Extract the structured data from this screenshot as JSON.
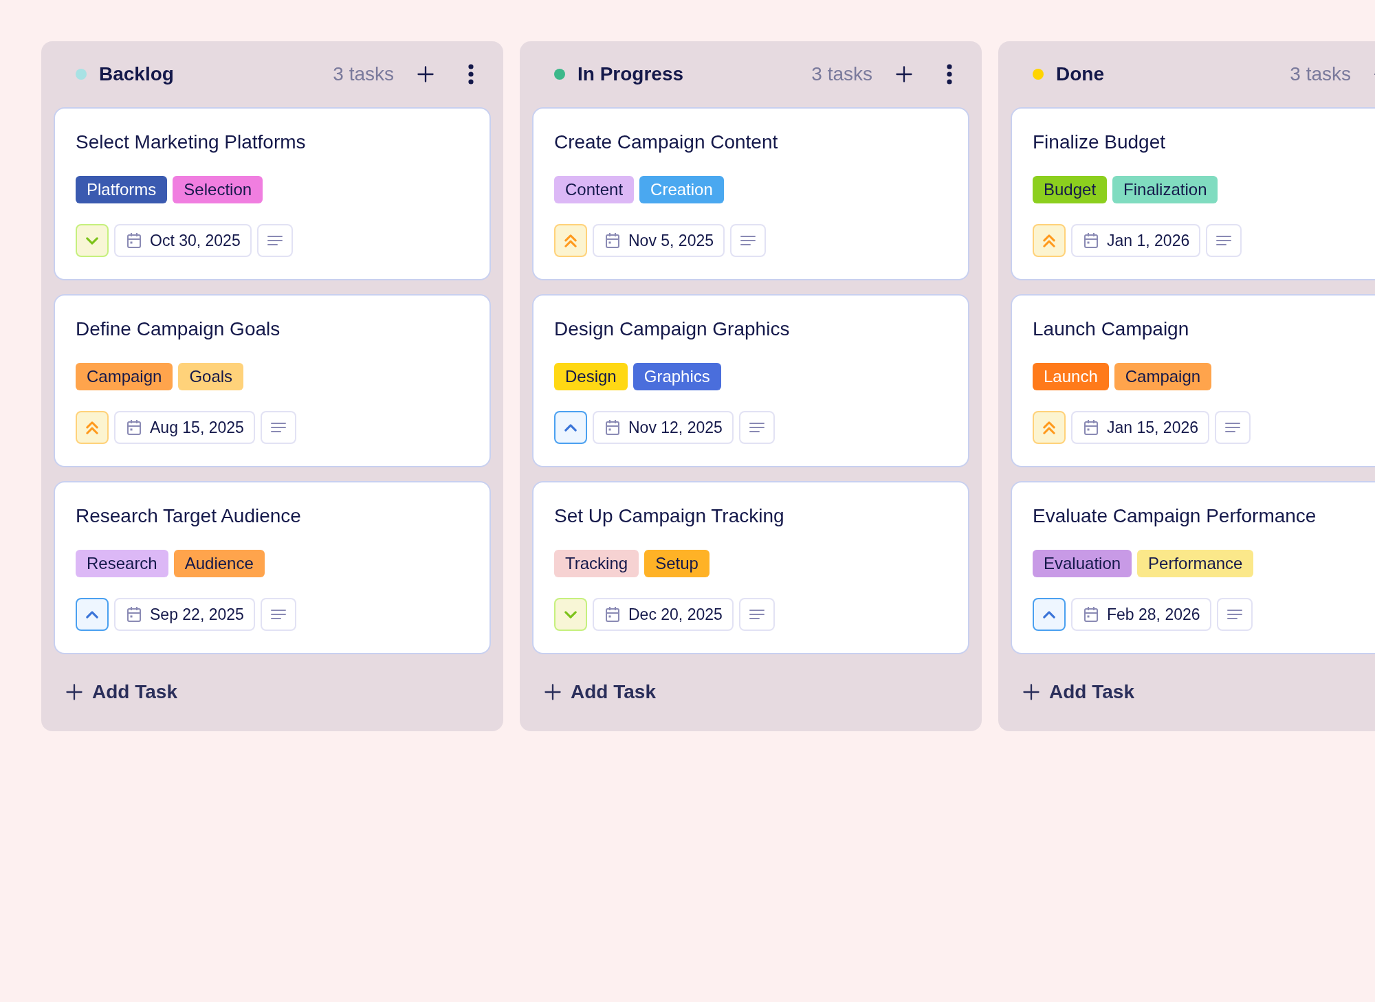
{
  "columns": [
    {
      "title": "Backlog",
      "color": "#a8e2e4",
      "count": "3 tasks",
      "add_label": "Add Task",
      "cards": [
        {
          "title": "Select Marketing Platforms",
          "tags": [
            {
              "label": "Platforms",
              "color": "#3a5ab0"
            },
            {
              "label": "Selection",
              "color": "#f07ee0"
            }
          ],
          "priority": {
            "kind": "low"
          },
          "date": "Oct 30, 2025"
        },
        {
          "title": "Define Campaign Goals",
          "tags": [
            {
              "label": "Campaign",
              "color": "#ffa44c"
            },
            {
              "label": "Goals",
              "color": "#ffd27a"
            }
          ],
          "priority": {
            "kind": "high"
          },
          "date": "Aug 15, 2025"
        },
        {
          "title": "Research Target Audience",
          "tags": [
            {
              "label": "Research",
              "color": "#dcb8f6"
            },
            {
              "label": "Audience",
              "color": "#ffa44c"
            }
          ],
          "priority": {
            "kind": "medium"
          },
          "date": "Sep 22, 2025"
        }
      ]
    },
    {
      "title": "In Progress",
      "color": "#3cb88a",
      "count": "3 tasks",
      "add_label": "Add Task",
      "cards": [
        {
          "title": "Create Campaign Content",
          "tags": [
            {
              "label": "Content",
              "color": "#dcb8f6"
            },
            {
              "label": "Creation",
              "color": "#4aa8f0"
            }
          ],
          "priority": {
            "kind": "high"
          },
          "date": "Nov 5, 2025"
        },
        {
          "title": "Design Campaign Graphics",
          "tags": [
            {
              "label": "Design",
              "color": "#ffd814"
            },
            {
              "label": "Graphics",
              "color": "#4a6edc"
            }
          ],
          "priority": {
            "kind": "medium"
          },
          "date": "Nov 12, 2025"
        },
        {
          "title": "Set Up Campaign Tracking",
          "tags": [
            {
              "label": "Tracking",
              "color": "#f6d2d2"
            },
            {
              "label": "Setup",
              "color": "#ffb226"
            }
          ],
          "priority": {
            "kind": "low"
          },
          "date": "Dec 20, 2025"
        }
      ]
    },
    {
      "title": "Done",
      "color": "#ffd400",
      "count": "3 tasks",
      "add_label": "Add Task",
      "cards": [
        {
          "title": "Finalize Budget",
          "tags": [
            {
              "label": "Budget",
              "color": "#8ccf1e"
            },
            {
              "label": "Finalization",
              "color": "#80dcc0"
            }
          ],
          "priority": {
            "kind": "high"
          },
          "date": "Jan 1, 2026"
        },
        {
          "title": "Launch Campaign",
          "tags": [
            {
              "label": "Launch",
              "color": "#ff7a1a"
            },
            {
              "label": "Campaign",
              "color": "#ffa44c"
            }
          ],
          "priority": {
            "kind": "high"
          },
          "date": "Jan 15, 2026"
        },
        {
          "title": "Evaluate Campaign Performance",
          "tags": [
            {
              "label": "Evaluation",
              "color": "#c89ae6"
            },
            {
              "label": "Performance",
              "color": "#fbe88a"
            }
          ],
          "priority": {
            "kind": "medium"
          },
          "date": "Feb 28, 2026"
        }
      ]
    }
  ]
}
